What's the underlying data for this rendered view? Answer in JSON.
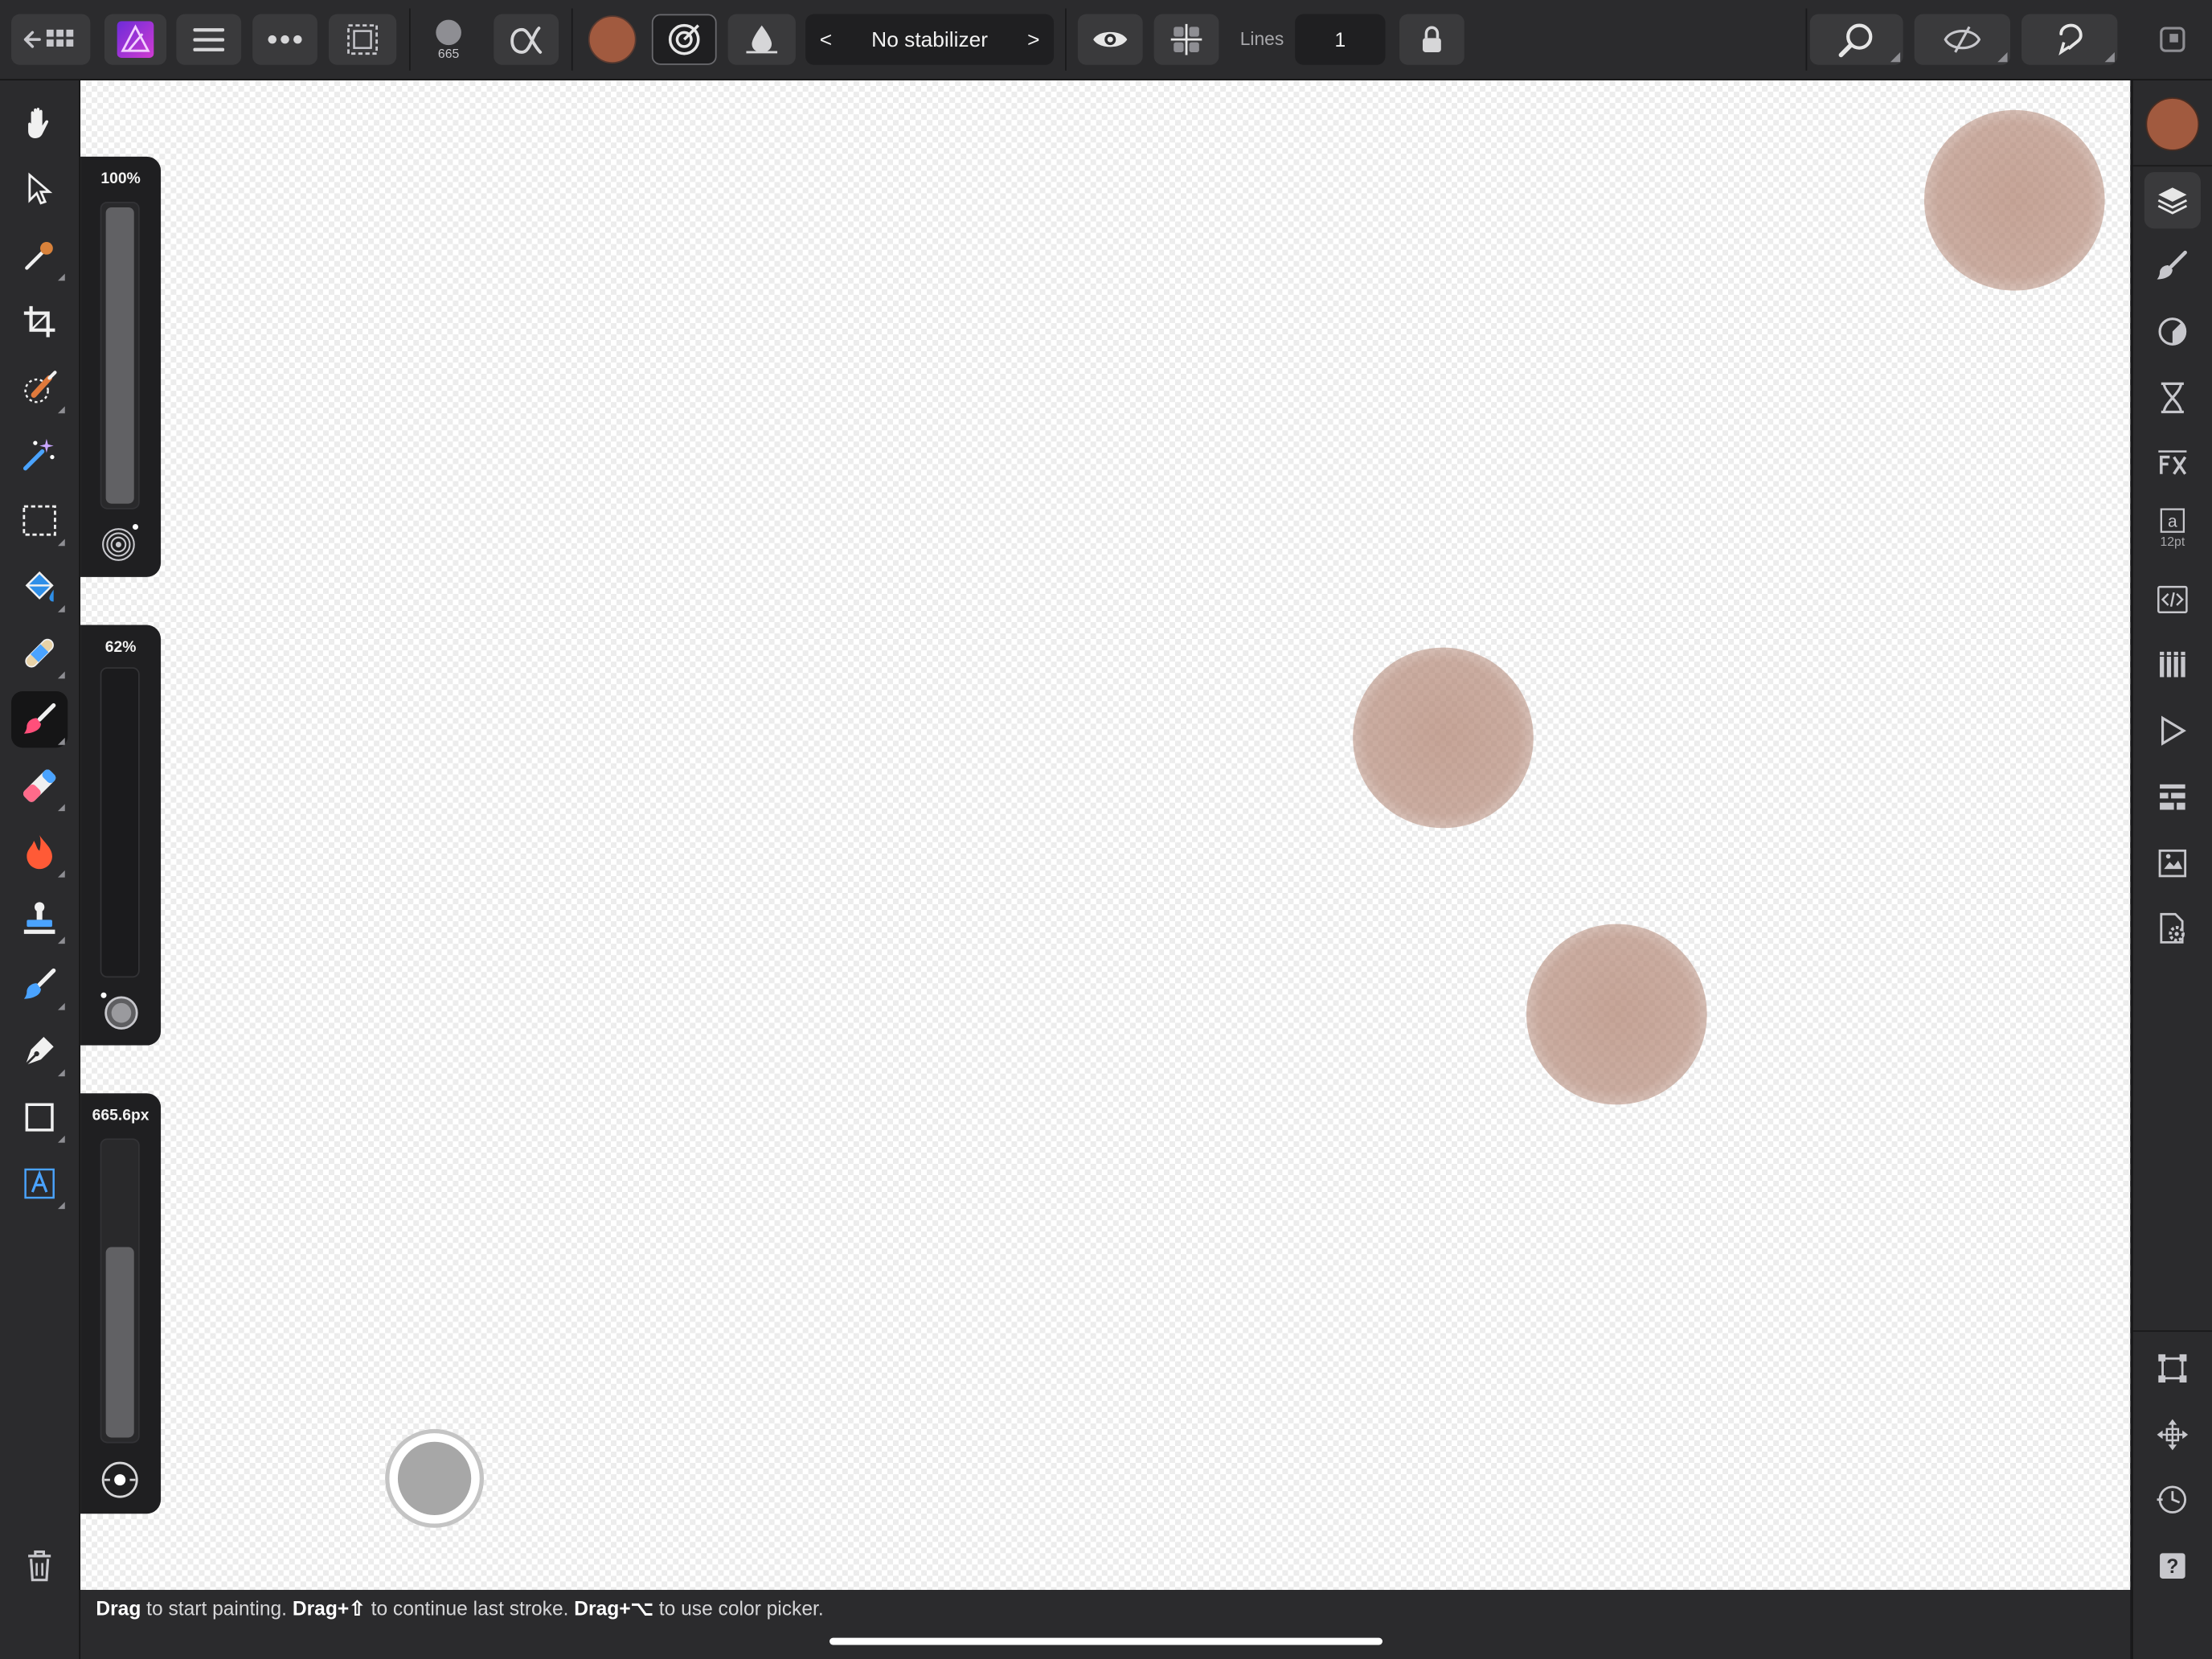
{
  "toolbar": {
    "brush_size_value": "665",
    "stabilizer_label": "No stabilizer",
    "stabilizer_prev": "<",
    "stabilizer_next": ">",
    "lines_label": "Lines",
    "lines_value": "1",
    "primary_color": "#a15a3f",
    "icons": [
      "back-to-gallery-icon",
      "affinity-photo-logo",
      "menu-icon",
      "more-icon",
      "selection-icon",
      "brush-size-icon",
      "alpha-icon",
      "color-swatch",
      "wet-edges-icon",
      "ink-drop-icon",
      "eye-icon",
      "symmetry-icon",
      "lock-icon",
      "zoom-icon",
      "assistant-icon",
      "undo-icon",
      "window-icon"
    ]
  },
  "left_tools": [
    "hand-tool",
    "move-tool",
    "color-picker-tool",
    "crop-tool",
    "selection-brush-tool",
    "flood-select-tool",
    "marquee-tool",
    "fill-tool",
    "healing-tool",
    "paint-brush-tool",
    "erase-brush-tool",
    "burn-tool",
    "clone-tool",
    "smudge-tool",
    "pen-tool",
    "rectangle-tool",
    "artistic-text-tool",
    "trash-icon"
  ],
  "sliders": {
    "opacity_label": "100%",
    "opacity_level": 1.0,
    "flow_label": "62%",
    "flow_level": 0.0,
    "size_label": "665.6px",
    "size_level": 0.65
  },
  "right_panel": {
    "current_color": "#a15a3f",
    "text_size_label": "12pt",
    "icons": [
      "layers-icon",
      "brushes-icon",
      "adjustments-icon",
      "history-icon",
      "fx-icon",
      "text-styles-icon",
      "code-icon",
      "swatches-icon",
      "play-icon",
      "navigator-icon",
      "stock-icon",
      "settings-icon",
      "transform-icon",
      "move-icon",
      "snapping-icon",
      "help-icon"
    ]
  },
  "status": {
    "part1_bold": "Drag",
    "part1": " to start painting. ",
    "part2_bold": "Drag+⇧",
    "part2": " to continue last stroke. ",
    "part3_bold": "Drag+⌥",
    "part3": " to use color picker."
  }
}
